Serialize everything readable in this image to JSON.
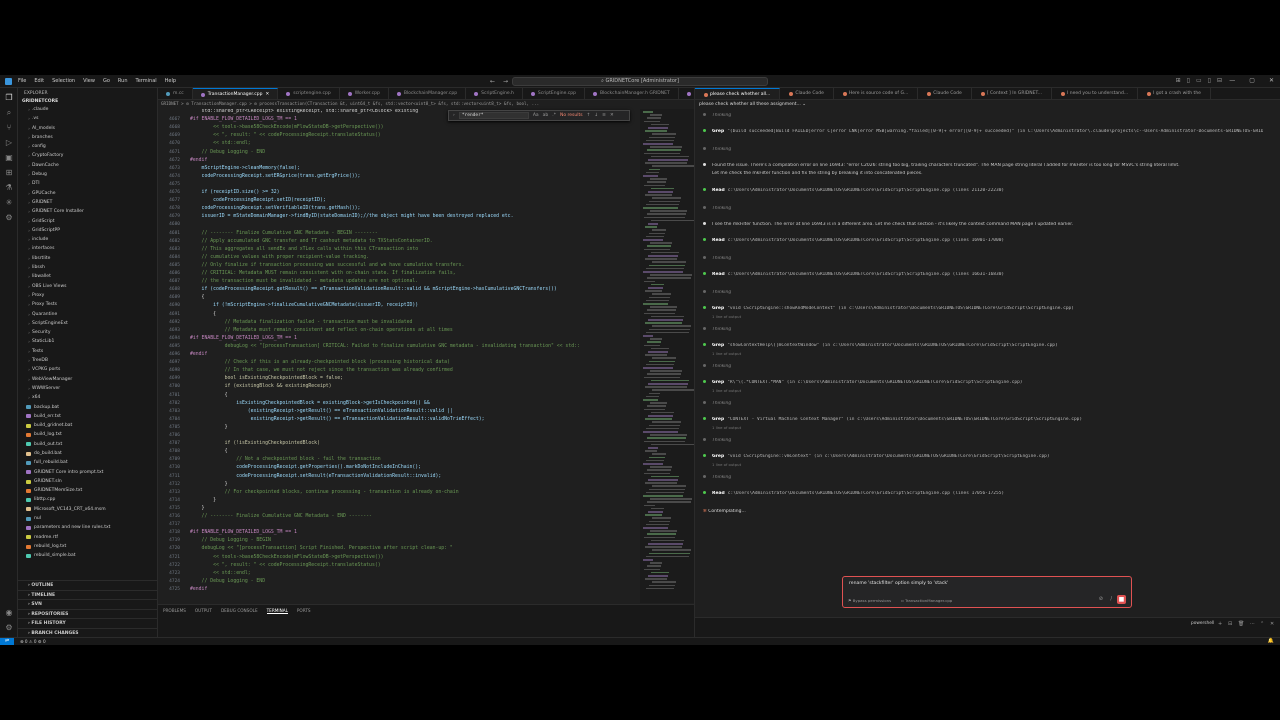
{
  "window": {
    "menu": [
      "File",
      "Edit",
      "Selection",
      "View",
      "Go",
      "Run",
      "Terminal",
      "Help"
    ],
    "command_center": "GRIDNETCore [Administrator]"
  },
  "sidebar": {
    "header": "EXPLORER",
    "root": "GRIDNETCORE",
    "items": [
      {
        "label": ".claude",
        "type": "folder"
      },
      {
        "label": ".vs",
        "type": "folder"
      },
      {
        "label": "AI_models",
        "type": "folder"
      },
      {
        "label": "branches",
        "type": "folder"
      },
      {
        "label": "config",
        "type": "folder"
      },
      {
        "label": "CryptoFactory",
        "type": "folder"
      },
      {
        "label": "DawnCache",
        "type": "folder"
      },
      {
        "label": "Debug",
        "type": "folder"
      },
      {
        "label": "DTI",
        "type": "folder"
      },
      {
        "label": "GPUCache",
        "type": "folder"
      },
      {
        "label": "GRIDNET",
        "type": "folder"
      },
      {
        "label": "GRIDNET Core Installer",
        "type": "folder"
      },
      {
        "label": "GridScript",
        "type": "folder"
      },
      {
        "label": "GridScriptPP",
        "type": "folder"
      },
      {
        "label": "include",
        "type": "folder"
      },
      {
        "label": "interfaces",
        "type": "folder"
      },
      {
        "label": "libsrtlite",
        "type": "folder"
      },
      {
        "label": "libssh",
        "type": "folder"
      },
      {
        "label": "libwallet",
        "type": "folder"
      },
      {
        "label": "OBS Live Views",
        "type": "folder"
      },
      {
        "label": "Proxy",
        "type": "folder"
      },
      {
        "label": "Proxy Tests",
        "type": "folder"
      },
      {
        "label": "Quarantine",
        "type": "folder"
      },
      {
        "label": "ScriptEngineExt",
        "type": "folder"
      },
      {
        "label": "Security",
        "type": "folder"
      },
      {
        "label": "StaticLib1",
        "type": "folder"
      },
      {
        "label": "Tests",
        "type": "folder"
      },
      {
        "label": "TreeDB",
        "type": "folder"
      },
      {
        "label": "VCPKG ports",
        "type": "folder"
      },
      {
        "label": "WebViewManager",
        "type": "folder"
      },
      {
        "label": "WWWServer",
        "type": "folder"
      },
      {
        "label": "x64",
        "type": "folder"
      },
      {
        "label": "backup.bat",
        "type": "file"
      },
      {
        "label": "build_err.txt",
        "type": "file"
      },
      {
        "label": "build_gridnet.bat",
        "type": "file"
      },
      {
        "label": "build_log.txt",
        "type": "file"
      },
      {
        "label": "build_out.txt",
        "type": "file"
      },
      {
        "label": "do_build.bat",
        "type": "file"
      },
      {
        "label": "full_rebuild.bat",
        "type": "file"
      },
      {
        "label": "GRIDNET Core intro prompt.txt",
        "type": "file"
      },
      {
        "label": "GRIDNET.sln",
        "type": "file"
      },
      {
        "label": "GRIDNETMemSize.txt",
        "type": "file"
      },
      {
        "label": "libttp.cpp",
        "type": "file"
      },
      {
        "label": "Microsoft_VC143_CRT_x64.msm",
        "type": "file"
      },
      {
        "label": "nul",
        "type": "file"
      },
      {
        "label": "parameters and new line rules.txt",
        "type": "file"
      },
      {
        "label": "readme.rtf",
        "type": "file"
      },
      {
        "label": "rebuild_log.txt",
        "type": "file"
      },
      {
        "label": "rebuild_simple.bat",
        "type": "file"
      }
    ],
    "footer": [
      "OUTLINE",
      "TIMELINE",
      "SVN",
      "REPOSITORIES",
      "FILE HISTORY",
      "BRANCH CHANGES"
    ]
  },
  "editor": {
    "tabs": [
      {
        "label": "m.cc",
        "active": false
      },
      {
        "label": "TransactionManager.cpp",
        "active": true
      },
      {
        "label": "scriptengine.cpp",
        "active": false
      },
      {
        "label": "Worker.cpp",
        "active": false
      },
      {
        "label": "BlockchainManager.cpp",
        "active": false
      },
      {
        "label": "ScriptEngine.h",
        "active": false
      },
      {
        "label": "ScriptEngine.cpp",
        "active": false
      },
      {
        "label": "BlockchainManager.h GRIDNET",
        "active": false
      },
      {
        "label": "BlockchainManager.h",
        "active": false
      }
    ],
    "breadcrumb": "GRIDNET > ⚙ TransactionManager.cpp > ⚙ processTransaction(CTransaction &t, uint64_t &fs, std::vector<uint8_t> &fs, std::vector<uint8_t> &fs, bool, ...",
    "find": {
      "query": "*render*",
      "result": "No results"
    },
    "lines": [
      {
        "n": "",
        "t": "    std::shared_ptr<CReceipt> existingReceipt, std::shared_ptr<CBlock> existing",
        "cls": ""
      },
      {
        "n": "4667",
        "t": "#if ENABLE_FLOW_DETAILED_LOGS_TM == 1",
        "cls": "k"
      },
      {
        "n": "4668",
        "t": "        << tools->base58CheckEncode(mFlowStateDB->getPerspective())",
        "cls": "c"
      },
      {
        "n": "4669",
        "t": "        << \", result: \" << codeProcessingReceipt.translateStatus()",
        "cls": "c"
      },
      {
        "n": "4670",
        "t": "        << std::endl;",
        "cls": "c"
      },
      {
        "n": "4671",
        "t": "    // Debug Logging - END",
        "cls": "c"
      },
      {
        "n": "4672",
        "t": "#endif",
        "cls": "k"
      },
      {
        "n": "4673",
        "t": "    mScriptEngine->cleanMemory(false);",
        "cls": ""
      },
      {
        "n": "4674",
        "t": "    codeProcessingReceipt.setERGprice(trans.getErgPrice());",
        "cls": ""
      },
      {
        "n": "4675",
        "t": "",
        "cls": ""
      },
      {
        "n": "4676",
        "t": "    if (receiptID.size() >= 32)",
        "cls": ""
      },
      {
        "n": "4677",
        "t": "        codeProcessingReceipt.setID(receiptID);",
        "cls": ""
      },
      {
        "n": "4678",
        "t": "    codeProcessingReceipt.setVerifiableID(trans.getHash());",
        "cls": ""
      },
      {
        "n": "4679",
        "t": "    issuerID = mStateDomainManager->findByID(stateDomainID);//the object might have been destroyed replaced etc.",
        "cls": ""
      },
      {
        "n": "4680",
        "t": "",
        "cls": ""
      },
      {
        "n": "4681",
        "t": "    // -------- Finalize Cumulative GNC Metadata - BEGIN --------",
        "cls": "c"
      },
      {
        "n": "4682",
        "t": "    // Apply accumulated GNC transfer and TT cashout metadata to TXStatsContainerID.",
        "cls": "c"
      },
      {
        "n": "4683",
        "t": "    // This aggregates all sendEx and xTLex calls within this CTransaction into",
        "cls": "c"
      },
      {
        "n": "4684",
        "t": "    // cumulative values with proper recipient-value tracking.",
        "cls": "c"
      },
      {
        "n": "4685",
        "t": "    // Only finalize if transaction processing was successful and we have cumulative transfers.",
        "cls": "c"
      },
      {
        "n": "4686",
        "t": "    // CRITICAL: Metadata MUST remain consistent with on-chain state. If finalization fails,",
        "cls": "c"
      },
      {
        "n": "4687",
        "t": "    // the transaction must be invalidated - metadata updates are not optional.",
        "cls": "c"
      },
      {
        "n": "4688",
        "t": "    if (codeProcessingReceipt.getResult() == eTransactionValidationResult::valid && mScriptEngine->hasCumulativeGNCTransfers())",
        "cls": ""
      },
      {
        "n": "4689",
        "t": "    {",
        "cls": ""
      },
      {
        "n": "4690",
        "t": "        if (!mScriptEngine->finalizeCumulativeGNCMetadata(issuerID, receiptID))",
        "cls": ""
      },
      {
        "n": "4691",
        "t": "        {",
        "cls": ""
      },
      {
        "n": "4692",
        "t": "            // Metadata finalization failed - transaction must be invalidated",
        "cls": "c"
      },
      {
        "n": "4693",
        "t": "            // Metadata must remain consistent and reflect on-chain operations at all times",
        "cls": "c"
      },
      {
        "n": "4694",
        "t": "#if ENABLE_FLOW_DETAILED_LOGS_TM == 1",
        "cls": "k"
      },
      {
        "n": "4695",
        "t": "            debugLog << \"[processTransaction] CRITICAL: Failed to finalize cumulative GNC metadata - invalidating transaction\" << std::",
        "cls": "c"
      },
      {
        "n": "4696",
        "t": "#endif",
        "cls": "k"
      },
      {
        "n": "4697",
        "t": "            // Check if this is an already-checkpointed block (processing historical data)",
        "cls": "c"
      },
      {
        "n": "4698",
        "t": "            // In that case, we must not reject since the transaction was already confirmed",
        "cls": "c"
      },
      {
        "n": "4699",
        "t": "            bool isExistingCheckpointedBlock = false;",
        "cls": ""
      },
      {
        "n": "4700",
        "t": "            if (existingBlock && existingReceipt)",
        "cls": ""
      },
      {
        "n": "4701",
        "t": "            {",
        "cls": ""
      },
      {
        "n": "4702",
        "t": "                isExistingCheckpointedBlock = existingBlock->getIsCheckpointed() &&",
        "cls": ""
      },
      {
        "n": "4703",
        "t": "                    (existingReceipt->getResult() == eTransactionValidationResult::valid ||",
        "cls": ""
      },
      {
        "n": "4704",
        "t": "                     existingReceipt->getResult() == eTransactionValidationResult::validNoTrieEffect);",
        "cls": ""
      },
      {
        "n": "4705",
        "t": "            }",
        "cls": ""
      },
      {
        "n": "4706",
        "t": "",
        "cls": ""
      },
      {
        "n": "4707",
        "t": "            if (!isExistingCheckpointedBlock)",
        "cls": ""
      },
      {
        "n": "4708",
        "t": "            {",
        "cls": ""
      },
      {
        "n": "4709",
        "t": "                // Not a checkpointed block - fail the transaction",
        "cls": "c"
      },
      {
        "n": "4710",
        "t": "                codeProcessingReceipt.getProperties().markDoNotIncludeInChain();",
        "cls": ""
      },
      {
        "n": "4711",
        "t": "                codeProcessingReceipt.setResult(eTransactionValidationResult::invalid);",
        "cls": ""
      },
      {
        "n": "4712",
        "t": "            }",
        "cls": ""
      },
      {
        "n": "4713",
        "t": "            // For checkpointed blocks, continue processing - transaction is already on-chain",
        "cls": "c"
      },
      {
        "n": "4714",
        "t": "        }",
        "cls": ""
      },
      {
        "n": "4715",
        "t": "    }",
        "cls": ""
      },
      {
        "n": "4716",
        "t": "    // -------- Finalize Cumulative GNC Metadata - END --------",
        "cls": "c"
      },
      {
        "n": "4717",
        "t": "",
        "cls": ""
      },
      {
        "n": "4718",
        "t": "#if ENABLE_FLOW_DETAILED_LOGS_TM == 1",
        "cls": "k"
      },
      {
        "n": "4719",
        "t": "    // Debug Logging - BEGIN",
        "cls": "c"
      },
      {
        "n": "4720",
        "t": "    debugLog << \"[processTransaction] Script Finished. Perspective after script clean-up: \"",
        "cls": "c"
      },
      {
        "n": "4721",
        "t": "        << tools->base58CheckEncode(mFlowStateDB->getPerspective())",
        "cls": "c"
      },
      {
        "n": "4722",
        "t": "        << \", result: \" << codeProcessingReceipt.translateStatus()",
        "cls": "c"
      },
      {
        "n": "4723",
        "t": "        << std::endl;",
        "cls": "c"
      },
      {
        "n": "4724",
        "t": "    // Debug Logging - END",
        "cls": "c"
      },
      {
        "n": "4725",
        "t": "#endif",
        "cls": "k"
      }
    ]
  },
  "panel": {
    "tabs": [
      "PROBLEMS",
      "OUTPUT",
      "DEBUG CONSOLE",
      "TERMINAL",
      "PORTS"
    ],
    "active": "TERMINAL",
    "shell": "powershell"
  },
  "chat": {
    "tabs": [
      {
        "label": "please check whether all...",
        "active": true
      },
      {
        "label": "Claude Code",
        "active": false
      },
      {
        "label": "Here is source code of G...",
        "active": false
      },
      {
        "label": "Claude Code",
        "active": false
      },
      {
        "label": "[ Context ] In GRIDNET...",
        "active": false
      },
      {
        "label": "I need you to understand...",
        "active": false
      },
      {
        "label": "I got a crash with the",
        "active": false
      }
    ],
    "subtitle": "please check whether all these assignment... ⌄",
    "entries": [
      {
        "kind": "think",
        "text": "Thinking"
      },
      {
        "kind": "tool",
        "tool": "Grep",
        "text": "\"(build succeeded|Build FAILED|error C|error LNK|error MSB|warning.*failed|[0-9]+ error|[0-9]+ succeeded)\" (in C:\\Users\\Administrator\\.claude\\projects\\c--Users-Administrator-Documents-GRIDNETOS-GRIDNETCore\\tasks\\...\\tool-results\\toolu_...txt)",
        "sub": ""
      },
      {
        "kind": "think",
        "text": "Thinking"
      },
      {
        "kind": "text",
        "text": "Found the issue. There's a compilation error on line 16943: \"error C2026: string too big, trailing characters truncated\". The MAN page string literal I added for mkFilter is too long for MSVC's string literal limit.",
        "text2": "Let me check the mkFilter function and fix the string by breaking it into concatenated pieces."
      },
      {
        "kind": "tool",
        "tool": "Read",
        "text": "c:\\Users\\Administrator\\Documents\\GRIDNETOS\\GRIDNETCore\\GridScript\\ScriptEngine.cpp (lines 21120-22230)",
        "sub": ""
      },
      {
        "kind": "think",
        "text": "Thinking"
      },
      {
        "kind": "text",
        "text": "I see the mkFilter function. The error at line 16943 is in a different area. Let me check that section - it's likely the context command MAN page I updated earlier.",
        "text2": ""
      },
      {
        "kind": "tool",
        "tool": "Read",
        "text": "c:\\Users\\Administrator\\Documents\\GRIDNETOS\\GRIDNETCore\\GridScript\\ScriptEngine.cpp (lines 16901-17000)",
        "sub": ""
      },
      {
        "kind": "think",
        "text": "Thinking"
      },
      {
        "kind": "tool",
        "tool": "Read",
        "text": "c:\\Users\\Administrator\\Documents\\GRIDNETOS\\GRIDNETCore\\GridScript\\ScriptEngine.cpp (lines 16631-16830)",
        "sub": ""
      },
      {
        "kind": "think",
        "text": "Thinking"
      },
      {
        "kind": "tool",
        "tool": "Grep",
        "text": "\"void CScriptEngine::showAndModeContext\" (in c:\\Users\\Administrator\\Documents\\GRIDNETOS\\GRIDNETCore\\GridScript\\ScriptEngine.cpp)",
        "sub": "1 line of output"
      },
      {
        "kind": "think",
        "text": "Thinking"
      },
      {
        "kind": "tool",
        "tool": "Grep",
        "text": "\"showContextHelp\\(|mContextWindow\" (in c:\\Users\\Administrator\\Documents\\GRIDNETOS\\GRIDNETCore\\GridScript\\ScriptEngine.cpp)",
        "sub": "1 line of output"
      },
      {
        "kind": "think",
        "text": "Thinking"
      },
      {
        "kind": "tool",
        "tool": "Grep",
        "text": "\"R\\\"\\(.*CONTEXT.*MAN\" (in c:\\Users\\Administrator\\Documents\\GRIDNETOS\\GRIDNETCore\\GridScript\\ScriptEngine.cpp)",
        "sub": "1 line of output"
      },
      {
        "kind": "think",
        "text": "Thinking"
      },
      {
        "kind": "tool",
        "tool": "Grep",
        "text": "\"CONTEXT - Virtual Machine Context Manager\" (in c:\\Users\\Administrator\\Documents\\GRIDNETOS\\GRIDNETCore\\GridScript\\ScriptEngine.cpp)",
        "sub": "1 line of output"
      },
      {
        "kind": "think",
        "text": "Thinking"
      },
      {
        "kind": "tool",
        "tool": "Grep",
        "text": "\"void CScriptEngine::vmContext\" (in c:\\Users\\Administrator\\Documents\\GRIDNETOS\\GRIDNETCore\\GridScript\\ScriptEngine.cpp)",
        "sub": "1 line of output"
      },
      {
        "kind": "think",
        "text": "Thinking"
      },
      {
        "kind": "tool",
        "tool": "Read",
        "text": "c:\\Users\\Administrator\\Documents\\GRIDNETOS\\GRIDNETCore\\GridScript\\ScriptEngine.cpp (lines 17056-17255)",
        "sub": ""
      },
      {
        "kind": "status",
        "text": "Contemplating..."
      }
    ],
    "input": {
      "text": "rename 'stackfilter' option simply to 'stack'",
      "mode": "Bypass permissions",
      "file": "TransactionManager.cpp"
    }
  },
  "statusbar": {
    "text": "⊗ 0 ⚠ 0  ⚙ 0"
  },
  "colors": {
    "accent": "#0078d4",
    "error_border": "#e05252",
    "claude": "#d97757"
  }
}
